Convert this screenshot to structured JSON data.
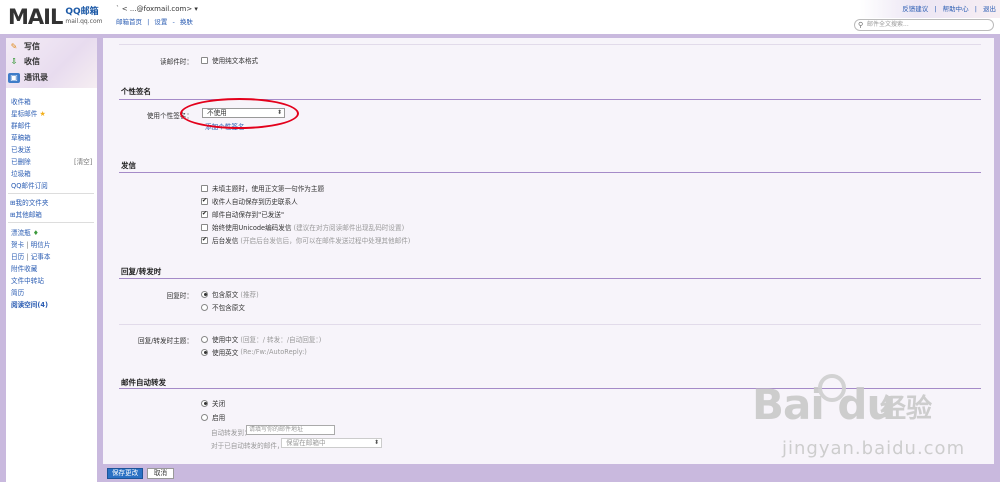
{
  "header": {
    "logo_mark": "MAIL",
    "logo_title": "QQ邮箱",
    "logo_domain": "mail.qq.com",
    "account": "` <    ...@foxmail.com> ▾",
    "links": [
      "邮箱首页",
      "|",
      "设置",
      "-",
      "换肤"
    ],
    "top_links": [
      "反馈建议",
      "|",
      "帮助中心",
      "|",
      "退出"
    ],
    "search_placeholder": "邮件全文搜索..."
  },
  "sidebar": {
    "write": "写信",
    "receive": "收信",
    "contacts": "通讯录",
    "folders": [
      "收件箱",
      "星标邮件",
      "群邮件",
      "草稿箱",
      "已发送",
      "已删除",
      "垃圾箱",
      "QQ邮件订阅"
    ],
    "clear_label": "[清空]",
    "my_folders": "⊞我的文件夹",
    "other_mailbox": "⊞其他邮箱",
    "drift_bottle": "漂流瓶",
    "card": "贺卡",
    "postcard": "明信片",
    "calendar": "日历",
    "notepad": "记事本",
    "attachments": "附件收藏",
    "transfer": "文件中转站",
    "resume": "简历",
    "reading_space": "阅读空间(4)",
    "separators": [
      "|",
      "|"
    ]
  },
  "main": {
    "reading": {
      "label": "读邮件时：",
      "plain_text": "使用纯文本格式"
    },
    "signature": {
      "title": "个性签名",
      "label": "使用个性签名：",
      "selected": "不使用",
      "add_link": "添加个性签名"
    },
    "sending": {
      "title": "发信",
      "options": [
        {
          "label": "未填主题时，使用正文第一句作为主题",
          "checked": false,
          "hint": ""
        },
        {
          "label": "收件人自动保存到历史联系人",
          "checked": true,
          "hint": ""
        },
        {
          "label": "邮件自动保存到\"已发送\"",
          "checked": true,
          "hint": ""
        },
        {
          "label": "始终使用Unicode编码发信",
          "checked": false,
          "hint": "(建议在对方阅读邮件出现乱码时设置)"
        },
        {
          "label": "后台发信",
          "checked": true,
          "hint": "(开启后台发信后，你可以在邮件发送过程中处理其他邮件)"
        }
      ]
    },
    "reply": {
      "title": "回复/转发时",
      "reply_label": "回复时：",
      "reply_options": [
        {
          "label": "包含原文",
          "hint": "(推荐)",
          "selected": true
        },
        {
          "label": "不包含原文",
          "hint": "",
          "selected": false
        }
      ],
      "subject_label": "回复/转发时主题：",
      "subject_options": [
        {
          "label": "使用中文",
          "hint": "(回复：/ 转发：/自动回复：)",
          "selected": false
        },
        {
          "label": "使用英文",
          "hint": "(Re:/Fw:/AutoReply:)",
          "selected": true
        }
      ]
    },
    "forward": {
      "title": "邮件自动转发",
      "options": [
        {
          "label": "关闭",
          "selected": true
        },
        {
          "label": "启用",
          "selected": false
        }
      ],
      "to_label": "自动转发到：",
      "to_placeholder": "请填写你的邮件地址",
      "after_label": "对于已自动转发的邮件，",
      "after_selected": "保留在邮箱中"
    }
  },
  "footer": {
    "save": "保存更改",
    "cancel": "取消"
  },
  "watermark": {
    "brand": "Bai du",
    "cn": "经验",
    "url": "jingyan.baidu.com"
  }
}
